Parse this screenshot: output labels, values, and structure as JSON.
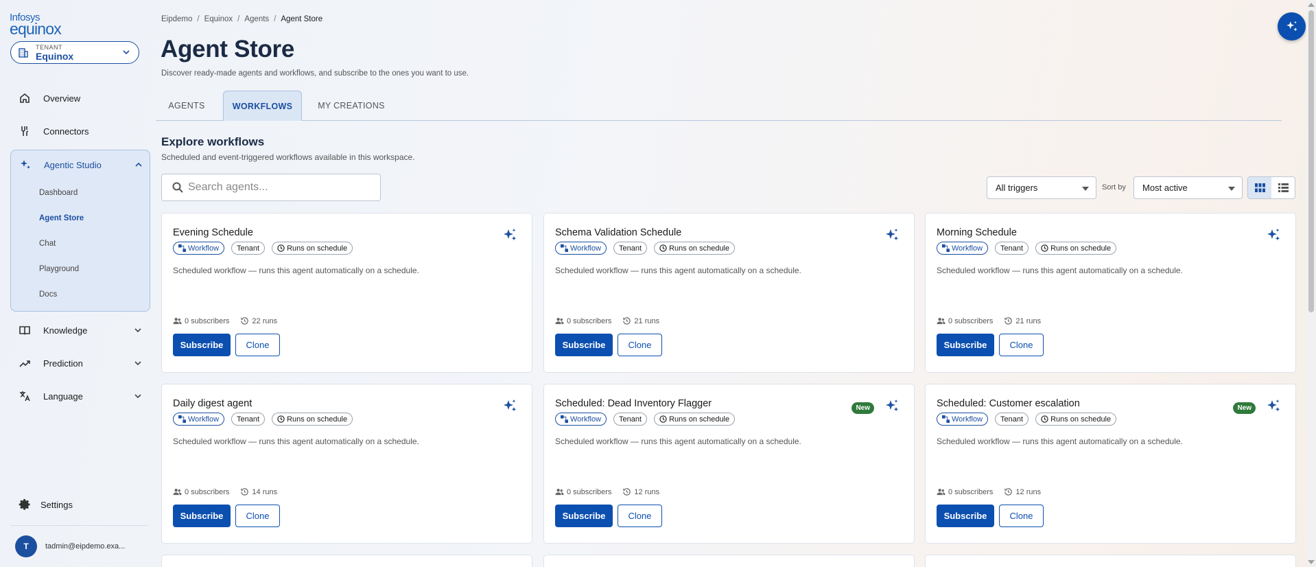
{
  "brand": {
    "line1": "Infosys",
    "line2": "equinox"
  },
  "tenant": {
    "caption": "TENANT",
    "value": "Equinox"
  },
  "nav": {
    "overview": "Overview",
    "connectors": "Connectors",
    "agentic_studio": "Agentic Studio",
    "studio_items": [
      "Dashboard",
      "Agent Store",
      "Chat",
      "Playground",
      "Docs"
    ],
    "knowledge": "Knowledge",
    "prediction": "Prediction",
    "language": "Language",
    "settings": "Settings"
  },
  "user": {
    "initial": "T",
    "email": "tadmin@eipdemo.exa..."
  },
  "breadcrumb": [
    "Eipdemo",
    "Equinox",
    "Agents",
    "Agent Store"
  ],
  "page": {
    "title": "Agent Store",
    "subtitle": "Discover ready-made agents and workflows, and subscribe to the ones you want to use."
  },
  "tabs": [
    "AGENTS",
    "WORKFLOWS",
    "MY CREATIONS"
  ],
  "section": {
    "title": "Explore workflows",
    "subtitle": "Scheduled and event-triggered workflows available in this workspace."
  },
  "search": {
    "placeholder": "Search agents..."
  },
  "filters": {
    "trigger": "All triggers",
    "sort_label": "Sort by",
    "sort": "Most active"
  },
  "chip_labels": {
    "workflow": "Workflow",
    "tenant": "Tenant",
    "schedule": "Runs on schedule"
  },
  "card_labels": {
    "subscribe": "Subscribe",
    "clone": "Clone",
    "new": "New"
  },
  "cards": [
    {
      "title": "Evening Schedule",
      "desc": "Scheduled workflow — runs this agent automatically on a schedule.",
      "subscribers": "0 subscribers",
      "runs": "22 runs",
      "is_new": false
    },
    {
      "title": "Schema Validation Schedule",
      "desc": "Scheduled workflow — runs this agent automatically on a schedule.",
      "subscribers": "0 subscribers",
      "runs": "21 runs",
      "is_new": false
    },
    {
      "title": "Morning Schedule",
      "desc": "Scheduled workflow — runs this agent automatically on a schedule.",
      "subscribers": "0 subscribers",
      "runs": "21 runs",
      "is_new": false
    },
    {
      "title": "Daily digest agent",
      "desc": "Scheduled workflow — runs this agent automatically on a schedule.",
      "subscribers": "0 subscribers",
      "runs": "14 runs",
      "is_new": false
    },
    {
      "title": "Scheduled: Dead Inventory Flagger",
      "desc": "Scheduled workflow — runs this agent automatically on a schedule.",
      "subscribers": "0 subscribers",
      "runs": "12 runs",
      "is_new": true
    },
    {
      "title": "Scheduled: Customer escalation",
      "desc": "Scheduled workflow — runs this agent automatically on a schedule.",
      "subscribers": "0 subscribers",
      "runs": "12 runs",
      "is_new": true
    }
  ],
  "colors": {
    "primary": "#0b4fb0",
    "new_badge": "#2f7a3b"
  }
}
